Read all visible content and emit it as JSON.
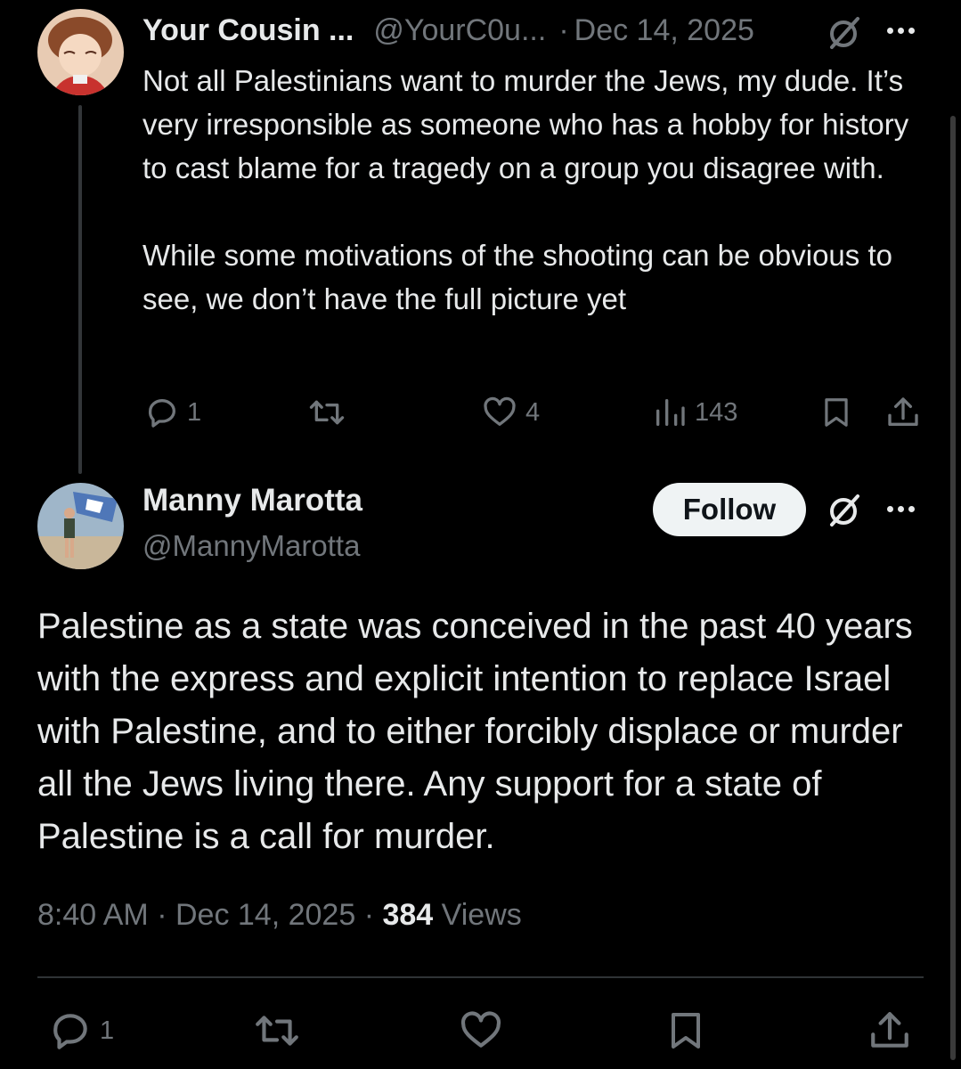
{
  "reply_tweet": {
    "display_name": "Your Cousin ...",
    "handle": "@YourC0u...",
    "separator": "·",
    "date": "Dec 14, 2025",
    "paragraphs": [
      "Not all Palestinians want to murder the Jews, my dude. It’s very irresponsible as someone who has a hobby for history to cast blame for a tragedy on a group you disagree with.",
      "While some motivations of the shooting can be obvious to see, we don’t have the full picture yet"
    ],
    "actions": {
      "reply_count": "1",
      "repost_count": "",
      "like_count": "4",
      "view_count": "143"
    },
    "icons": [
      "reply-icon",
      "repost-icon",
      "like-icon",
      "views-icon",
      "bookmark-icon",
      "share-icon",
      "grok-icon",
      "more-icon"
    ]
  },
  "main_tweet": {
    "display_name": "Manny Marotta",
    "handle": "@MannyMarotta",
    "follow_label": "Follow",
    "body": "Palestine as a state was conceived in the past 40 years with the express and explicit intention to replace Israel with Palestine, and to either forcibly displace or murder all the Jews living there. Any support for a state of Palestine is a call for murder.",
    "time": "8:40 AM",
    "date": "Dec 14, 2025",
    "separator": "·",
    "views_count": "384",
    "views_label": "Views",
    "actions": {
      "reply_count": "1"
    }
  },
  "colors": {
    "background": "#000000",
    "text": "#e7e9ea",
    "muted": "#71767b",
    "divider": "#2f3336",
    "follow_bg": "#eff3f4"
  }
}
